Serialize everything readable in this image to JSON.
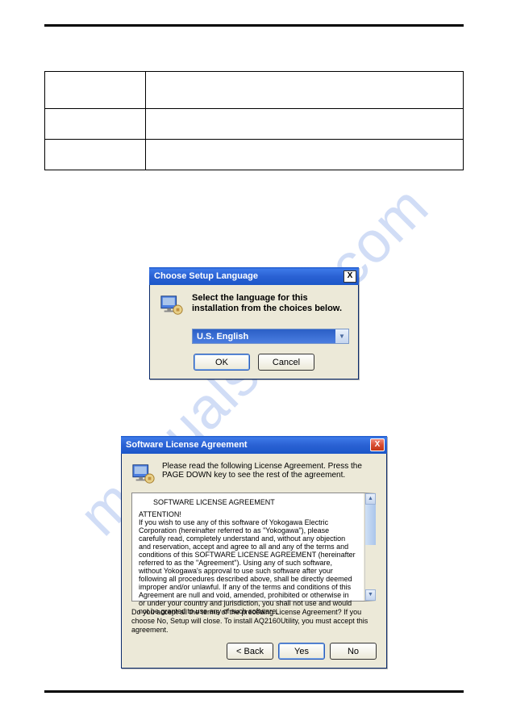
{
  "watermark": "manualshive.com",
  "table": {
    "rows": 3,
    "cols": 2
  },
  "dialog1": {
    "title": "Choose Setup Language",
    "message": "Select the language for this installation from the choices below.",
    "selected": "U.S. English",
    "ok": "OK",
    "cancel": "Cancel",
    "close": "X"
  },
  "dialog2": {
    "title": "Software License Agreement",
    "close": "X",
    "instruction": "Please read the following License Agreement. Press the PAGE DOWN key to see the rest of the agreement.",
    "license_header": "SOFTWARE LICENSE AGREEMENT",
    "attention": "ATTENTION!",
    "license_body": "If you wish to use any of this software of Yokogawa Electric Corporation (hereinafter referred to as \"Yokogawa\"), please carefully read, completely understand and, without any objection and reservation, accept and agree to all and any of the terms and conditions of this SOFTWARE LICENSE AGREEMENT (hereinafter referred to as the \"Agreement\"). Using any of such software, without Yokogawa's approval to use such software after your following all procedures described above, shall be directly deemed improper and/or unlawful. If any of the terms and conditions of this Agreement are null and void, amended, prohibited or otherwise in or under your country and jurisdiction, you shall not use and would not be granted to use any of such software.",
    "confirm": "Do you accept all the terms of the preceding License Agreement? If you choose No, Setup will close. To install AQ2160Utility, you must accept this agreement.",
    "back": "< Back",
    "yes": "Yes",
    "no": "No"
  }
}
